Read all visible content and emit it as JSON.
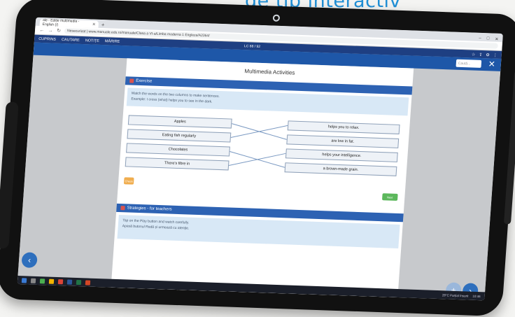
{
  "caption": "de tip interactiv",
  "browser": {
    "tab_title": "ale - Ediție multimedia - English (/)",
    "url": "Nesecurizat | www.manuale.edu.ro/manuale/Clasa a VI-a/Limba moderna 1 Engleza/A2364/"
  },
  "toolbar": {
    "item1": "CUPRINS",
    "item2": "CAUTARE",
    "item3": "NOTIȚE",
    "item4": "MĂRIRE",
    "center_label": "LC 88 / 92"
  },
  "viewer": {
    "search_placeholder": "Caută..."
  },
  "activity": {
    "title": "Multimedia Activities",
    "section1_title": "Exercise",
    "instructions_line1": "Match the words on the two columns to make sentences.",
    "instructions_line2": "Example: I cross (what) helps you to see in the dark.",
    "left_items": [
      "Apples",
      "Eating fish regularly",
      "Chocolates",
      "There's fibre in"
    ],
    "right_items": [
      "helps you to relax.",
      "are low in fat.",
      "helps your intelligence.",
      "a brown-made grain."
    ],
    "check_label": "Check",
    "next_label": "Next",
    "section2_title": "Strategies - for teachers",
    "tip_line1": "Tap on the Play button and watch carefully.",
    "tip_line2": "Apasă butonul Redă și urmează cu atenție."
  },
  "taskbar": {
    "tray_text": "28°C Parțial însorit",
    "clock": "10:46"
  },
  "colors": {
    "app_toolbar": "#1e3f82",
    "section_bar": "#2d62b3",
    "check": "#f0ad4e",
    "next": "#5cb85c",
    "nav_circle": "#2e6fbd"
  }
}
